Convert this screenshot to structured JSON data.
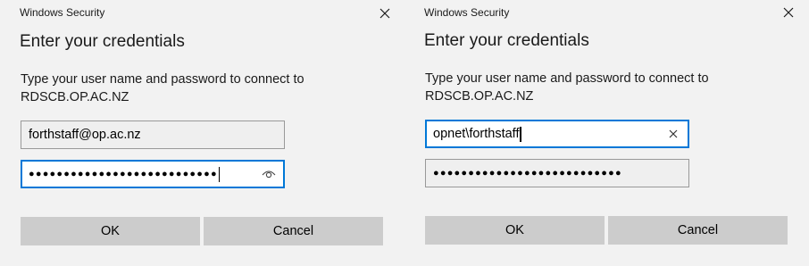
{
  "dialogs": [
    {
      "window_title": "Windows Security",
      "heading": "Enter your credentials",
      "prompt": "Type your user name and password to connect to RDSCB.OP.AC.NZ",
      "username": "forthstaff@op.ac.nz",
      "password_mask": "●●●●●●●●●●●●●●●●●●●●●●●●●●●",
      "password_icon": "reveal-password-eye-icon",
      "focused_field": "password",
      "ok_label": "OK",
      "cancel_label": "Cancel"
    },
    {
      "window_title": "Windows Security",
      "heading": "Enter your credentials",
      "prompt": "Type your user name and password to connect to RDSCB.OP.AC.NZ",
      "username": "opnet\\forthstaff",
      "username_icon": "clear-text-x-icon",
      "password_mask": "●●●●●●●●●●●●●●●●●●●●●●●●●●●",
      "focused_field": "username",
      "ok_label": "OK",
      "cancel_label": "Cancel"
    }
  ],
  "colors": {
    "background": "#f2f2f2",
    "focus_border": "#0078d7",
    "button": "#cccccc"
  }
}
